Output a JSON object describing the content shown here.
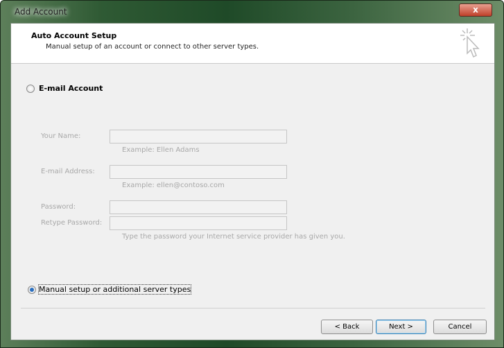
{
  "window": {
    "title": "Add Account",
    "close_label": "x"
  },
  "header": {
    "title": "Auto Account Setup",
    "subtitle": "Manual setup of an account or connect to other server types."
  },
  "options": {
    "email_account": "E-mail Account",
    "manual_setup": "Manual setup or additional server types",
    "selected": "manual_setup"
  },
  "form": {
    "your_name": {
      "label": "Your Name:",
      "value": "",
      "hint": "Example: Ellen Adams"
    },
    "email": {
      "label": "E-mail Address:",
      "value": "",
      "hint": "Example: ellen@contoso.com"
    },
    "password": {
      "label": "Password:",
      "value": ""
    },
    "retype": {
      "label": "Retype Password:",
      "value": "",
      "hint": "Type the password your Internet service provider has given you."
    }
  },
  "buttons": {
    "back": "< Back",
    "next": "Next >",
    "cancel": "Cancel"
  }
}
